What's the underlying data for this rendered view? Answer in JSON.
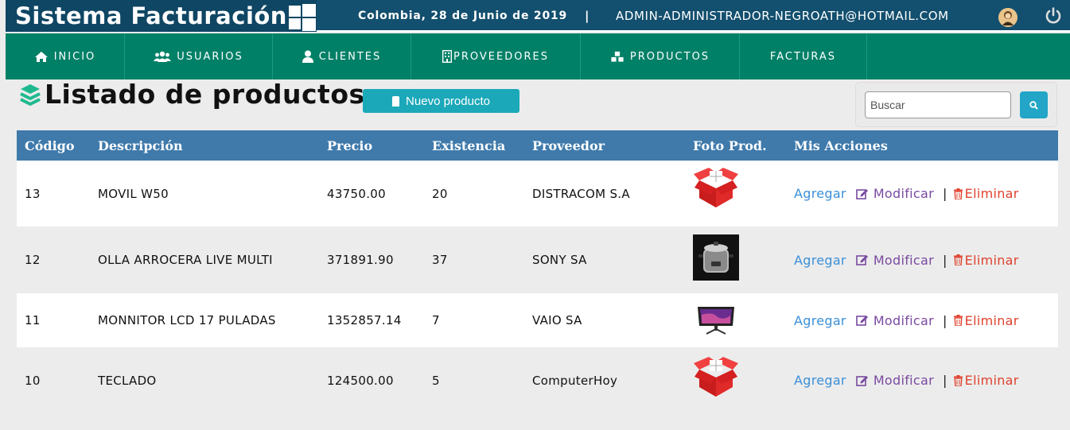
{
  "header": {
    "title": "Sistema Facturación",
    "date": "Colombia, 28 de Junio de 2019",
    "separator": "|",
    "user": "ADMIN-ADMINISTRADOR-NEGROATH@HOTMAIL.COM"
  },
  "nav": {
    "items": [
      {
        "label": "INICIO",
        "icon": "home-icon"
      },
      {
        "label": "USUARIOS",
        "icon": "users-icon"
      },
      {
        "label": "CLIENTES",
        "icon": "user-icon"
      },
      {
        "label": "PROVEEDORES",
        "icon": "building-icon"
      },
      {
        "label": "PRODUCTOS",
        "icon": "cubes-icon"
      },
      {
        "label": "FACTURAS",
        "icon": ""
      }
    ]
  },
  "page": {
    "title": "Listado de productos",
    "new_button": "Nuevo producto",
    "search_placeholder": "Buscar"
  },
  "table": {
    "headers": [
      "Código",
      "Descripción",
      "Precio",
      "Existencia",
      "Proveedor",
      "Foto Prod.",
      "Mis Acciones"
    ],
    "actions": {
      "add": "Agregar",
      "modify": "Modificar",
      "sep": "|",
      "delete": "Eliminar"
    },
    "rows": [
      {
        "code": "13",
        "desc": "MOVIL W50",
        "price": "43750.00",
        "stock": "20",
        "provider": "DISTRACOM S.A",
        "photo": "box-icon"
      },
      {
        "code": "12",
        "desc": "OLLA ARROCERA LIVE MULTI",
        "price": "371891.90",
        "stock": "37",
        "provider": "SONY SA",
        "photo": "rice-cooker-photo"
      },
      {
        "code": "11",
        "desc": "MONNITOR LCD 17 PULADAS",
        "price": "1352857.14",
        "stock": "7",
        "provider": "VAIO SA",
        "photo": "monitor-photo"
      },
      {
        "code": "10",
        "desc": "TECLADO",
        "price": "124500.00",
        "stock": "5",
        "provider": "ComputerHoy",
        "photo": "box-icon"
      }
    ]
  },
  "colors": {
    "header": "#134f6e",
    "nav": "#008067",
    "table_header": "#3f7aab",
    "new_button": "#1ba8b9",
    "add": "#3b8fd8",
    "modify": "#7a4aa0",
    "delete": "#e0432f"
  }
}
